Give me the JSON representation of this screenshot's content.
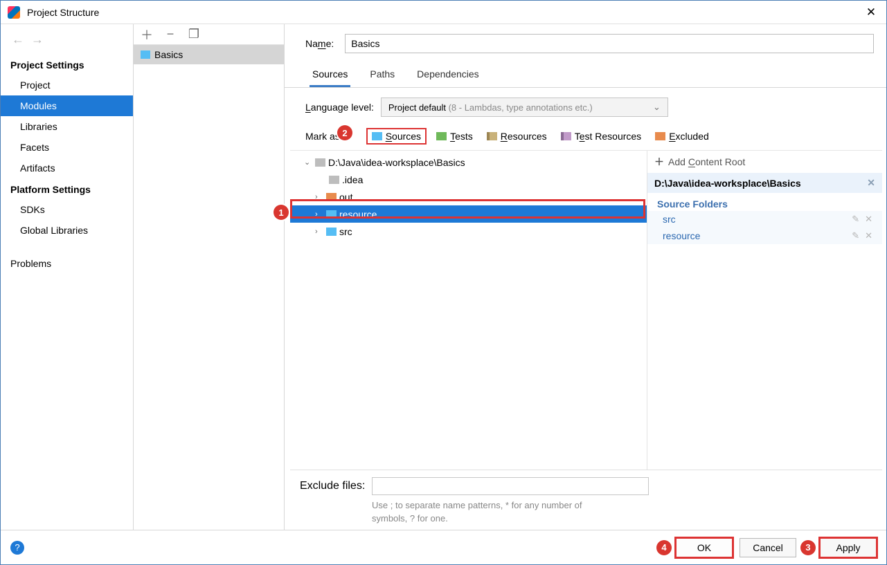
{
  "window": {
    "title": "Project Structure"
  },
  "nav": {
    "header1": "Project Settings",
    "items1": [
      "Project",
      "Modules",
      "Libraries",
      "Facets",
      "Artifacts"
    ],
    "header2": "Platform Settings",
    "items2": [
      "SDKs",
      "Global Libraries"
    ],
    "problems": "Problems",
    "selected": "Modules"
  },
  "modules": {
    "items": [
      "Basics"
    ],
    "selected": "Basics"
  },
  "main": {
    "name_label_pre": "Na",
    "name_label_mn": "m",
    "name_label_post": "e:",
    "name_value": "Basics",
    "tabs": [
      "Sources",
      "Paths",
      "Dependencies"
    ],
    "active_tab": "Sources",
    "lang_label_mn": "L",
    "lang_label_post": "anguage level:",
    "lang_value_pre": "Project default ",
    "lang_value_dim": "(8 - Lambdas, type annotations etc.)",
    "mark_label": "Mark as:",
    "mark_buttons": [
      {
        "mn": "S",
        "rest": "ources",
        "cls": "ic-src",
        "framed": true
      },
      {
        "mn": "T",
        "rest": "ests",
        "cls": "ic-tst"
      },
      {
        "mn": "R",
        "rest": "esources",
        "cls": "ic-res"
      },
      {
        "label": "T",
        "rest": "est Resources",
        "cls": "ic-tres"
      },
      {
        "mn": "E",
        "rest": "xcluded",
        "cls": "ic-exc"
      }
    ],
    "mark_idx4_pre": "T",
    "mark_idx4_mn": "e",
    "mark_idx4_post": "st Resources",
    "tree": {
      "root": "D:\\Java\\idea-worksplace\\Basics",
      "children": [
        {
          "name": ".idea",
          "color": "",
          "expand": false,
          "sel": false
        },
        {
          "name": "out",
          "color": "orange",
          "expand": true,
          "sel": false
        },
        {
          "name": "resource",
          "color": "blue",
          "expand": true,
          "sel": true
        },
        {
          "name": "src",
          "color": "blue",
          "expand": true,
          "sel": false
        }
      ]
    },
    "exclude_label": "Exclude files:",
    "exclude_value": "",
    "exclude_hint1": "Use ; to separate name patterns, * for any number of",
    "exclude_hint2": "symbols, ? for one."
  },
  "rightpane": {
    "add_label_pre": "Add ",
    "add_label_mn": "C",
    "add_label_post": "ontent Root",
    "root": "D:\\Java\\idea-worksplace\\Basics",
    "group": "Source Folders",
    "items": [
      "src",
      "resource"
    ]
  },
  "footer": {
    "ok": "OK",
    "cancel": "Cancel",
    "apply": "Apply"
  },
  "badges": {
    "b1": "1",
    "b2": "2",
    "b3": "3",
    "b4": "4"
  }
}
